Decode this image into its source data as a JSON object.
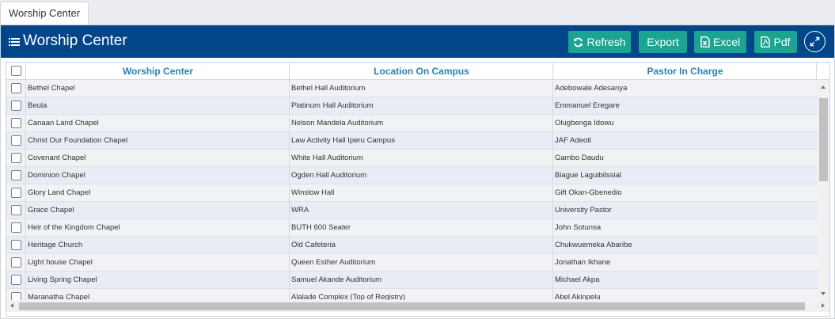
{
  "tab": {
    "label": "Worship Center"
  },
  "header": {
    "title": "Worship Center"
  },
  "toolbar": {
    "refresh_label": "Refresh",
    "export_label": "Export",
    "excel_label": "Excel",
    "pdf_label": "Pdf"
  },
  "grid": {
    "columns": [
      "Worship Center",
      "Location On Campus",
      "Pastor In Charge"
    ],
    "rows": [
      [
        "Bethel Chapel",
        "Bethel Hall Auditorium",
        "Adebowale Adesanya"
      ],
      [
        "Beula",
        "Platinum Hall Auditorium",
        "Emmanuel Eregare"
      ],
      [
        "Canaan Land Chapel",
        "Nelson Mandela Auditorium",
        "Olugbenga Idowu"
      ],
      [
        "Christ Our Foundation Chapel",
        "Law Activity Hall Iperu Campus",
        "JAF Adeoti"
      ],
      [
        "Covenant Chapel",
        "White Hall Auditorium",
        "Gambo Daudu"
      ],
      [
        "Dominion Chapel",
        "Ogden Hall Auditorium",
        "Biague Laguibilssial"
      ],
      [
        "Glory Land Chapel",
        "Winslow Hall",
        "Gift Okan-Gbenedio"
      ],
      [
        "Grace Chapel",
        "WRA",
        "University Pastor"
      ],
      [
        "Heir of the Kingdom Chapel",
        "BUTH 600 Seater",
        "John Sotunsa"
      ],
      [
        "Heritage Church",
        "Old Cafeteria",
        "Chukwuemeka Abaribe"
      ],
      [
        "Light house Chapel",
        "Queen Esther Auditorium",
        "Jonathan Ikhane"
      ],
      [
        "Living Spring Chapel",
        "Samuel Akande Auditorium",
        "Michael Akpa"
      ],
      [
        "Maranatha Chapel",
        "Alalade Complex (Top of Registry)",
        "Abel Akinpelu"
      ]
    ]
  },
  "colors": {
    "header_bg": "#02468a",
    "button_bg": "#1aa491",
    "column_header_text": "#2a83bc"
  },
  "icons": [
    "menu-icon",
    "refresh-icon",
    "excel-icon",
    "pdf-icon",
    "expand-icon",
    "checkbox"
  ]
}
